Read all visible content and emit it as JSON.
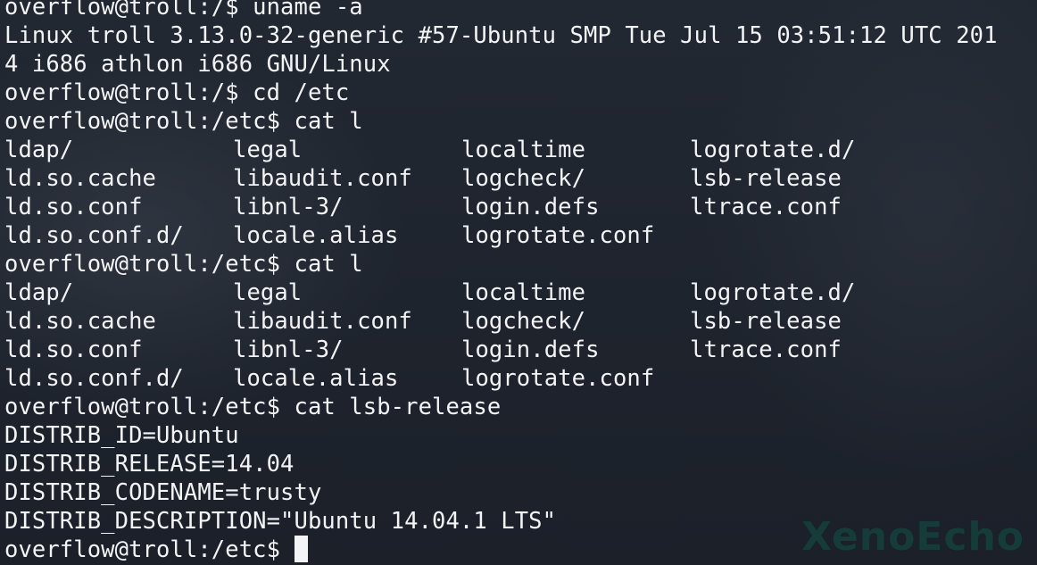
{
  "terminal": {
    "lines": [
      {
        "type": "text",
        "text": "overflow@troll:/$ uname -a"
      },
      {
        "type": "text",
        "text": "Linux troll 3.13.0-32-generic #57-Ubuntu SMP Tue Jul 15 03:51:12 UTC 201"
      },
      {
        "type": "text",
        "text": "4 i686 athlon i686 GNU/Linux"
      },
      {
        "type": "text",
        "text": "overflow@troll:/$ cd /etc"
      },
      {
        "type": "text",
        "text": "overflow@troll:/etc$ cat l"
      },
      {
        "type": "cols",
        "cols": [
          "ldap/",
          "legal",
          "localtime",
          "logrotate.d/"
        ]
      },
      {
        "type": "cols",
        "cols": [
          "ld.so.cache",
          "libaudit.conf",
          "logcheck/",
          "lsb-release"
        ]
      },
      {
        "type": "cols",
        "cols": [
          "ld.so.conf",
          "libnl-3/",
          "login.defs",
          "ltrace.conf"
        ]
      },
      {
        "type": "cols",
        "cols": [
          "ld.so.conf.d/",
          "locale.alias",
          "logrotate.conf",
          ""
        ]
      },
      {
        "type": "text",
        "text": "overflow@troll:/etc$ cat l"
      },
      {
        "type": "cols",
        "cols": [
          "ldap/",
          "legal",
          "localtime",
          "logrotate.d/"
        ]
      },
      {
        "type": "cols",
        "cols": [
          "ld.so.cache",
          "libaudit.conf",
          "logcheck/",
          "lsb-release"
        ]
      },
      {
        "type": "cols",
        "cols": [
          "ld.so.conf",
          "libnl-3/",
          "login.defs",
          "ltrace.conf"
        ]
      },
      {
        "type": "cols",
        "cols": [
          "ld.so.conf.d/",
          "locale.alias",
          "logrotate.conf",
          ""
        ]
      },
      {
        "type": "text",
        "text": "overflow@troll:/etc$ cat lsb-release"
      },
      {
        "type": "text",
        "text": "DISTRIB_ID=Ubuntu"
      },
      {
        "type": "text",
        "text": "DISTRIB_RELEASE=14.04"
      },
      {
        "type": "text",
        "text": "DISTRIB_CODENAME=trusty"
      },
      {
        "type": "text",
        "text": "DISTRIB_DESCRIPTION=\"Ubuntu 14.04.1 LTS\""
      }
    ],
    "prompt": "overflow@troll:/etc$ ",
    "colors": {
      "foreground": "#f3f4f6",
      "background": "#1d232c"
    }
  },
  "watermark": {
    "text": "XenoEcho",
    "color": "#163c3a"
  }
}
